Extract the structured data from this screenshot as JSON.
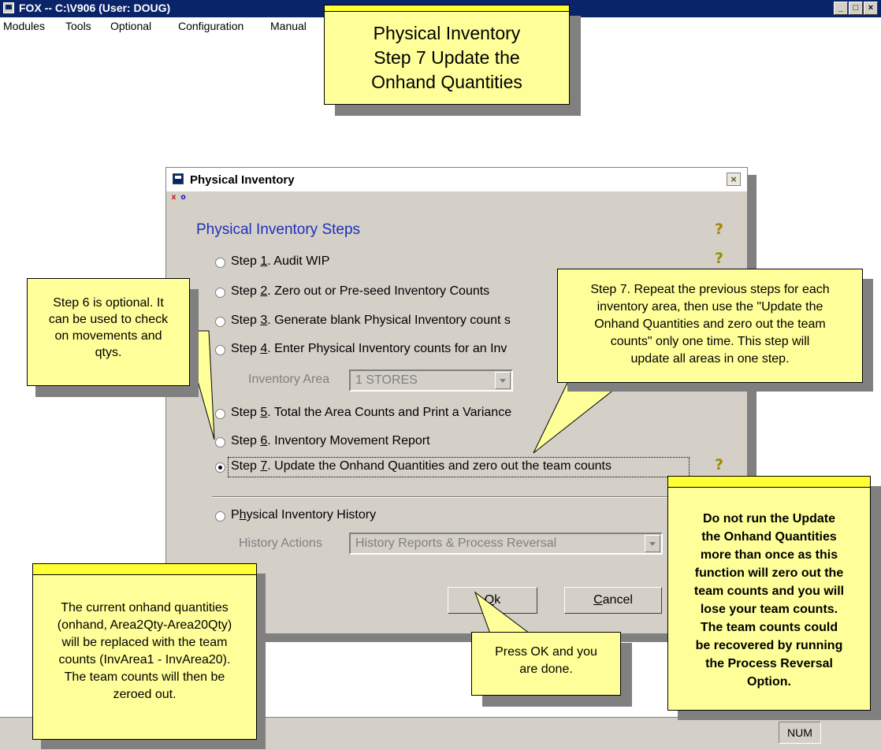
{
  "window": {
    "title": "FOX -- C:\\V906  (User: DOUG)",
    "controls": [
      "minimize",
      "maximize",
      "close"
    ]
  },
  "menu": [
    "Modules",
    "Tools",
    "Optional",
    "Configuration",
    "Manual"
  ],
  "dialog": {
    "title": "Physical Inventory",
    "mini_icons": [
      "x",
      "o"
    ],
    "heading": "Physical Inventory Steps",
    "steps": [
      {
        "prefix": "Step ",
        "key": "1",
        "rest": ".  Audit WIP"
      },
      {
        "prefix": "Step ",
        "key": "2",
        "rest": ".  Zero out or Pre-seed Inventory Counts"
      },
      {
        "prefix": "Step ",
        "key": "3",
        "rest": ".  Generate blank Physical Inventory count s"
      },
      {
        "prefix": "Step ",
        "key": "4",
        "rest": ".  Enter Physical Inventory counts for an Inv"
      },
      {
        "prefix": "Step ",
        "key": "5",
        "rest": ".  Total the Area Counts and Print a Variance"
      },
      {
        "prefix": "Step ",
        "key": "6",
        "rest": ".  Inventory Movement Report"
      },
      {
        "prefix": "Step ",
        "key": "7",
        "rest": ".  Update the Onhand Quantities and zero out the team counts"
      }
    ],
    "selected_step": "7",
    "inventory_area": {
      "label": "Inventory Area",
      "value": "1  STORES"
    },
    "history": {
      "prefix": "P",
      "key": "h",
      "rest": "ysical Inventory History"
    },
    "history_actions": {
      "label": "History Actions",
      "value": "History Reports & Process Reversal"
    },
    "ok_label": {
      "key": "O",
      "rest": "k"
    },
    "cancel_label": {
      "key": "C",
      "rest": "ancel"
    },
    "help_glyph": "?"
  },
  "status": {
    "num": "NUM"
  },
  "callouts": {
    "title": [
      "Physical Inventory",
      "Step 7 Update the",
      "Onhand Quantities"
    ],
    "step6": [
      "Step 6 is optional.  It",
      "can be used to check",
      "on movements and",
      "qtys."
    ],
    "step7": [
      "Step 7. Repeat the previous steps for each",
      "inventory area, then use the \"Update the",
      "Onhand Quantities and zero out the team",
      "counts\" only one time. This step will",
      "update all areas in one step."
    ],
    "warning": [
      "Do not run the Update",
      "the Onhand Quantities",
      "more than once as this",
      "function will zero out the",
      "team counts and you will",
      "lose your team counts.",
      "The team counts could",
      "be recovered by running",
      "the Process Reversal",
      "Option."
    ],
    "onhand": [
      "The current onhand quantities",
      "(onhand, Area2Qty-Area20Qty)",
      "will be replaced with the team",
      "counts (InvArea1 - InvArea20).",
      "The team counts will then be",
      "zeroed out."
    ],
    "ok": [
      "Press OK and you",
      "are done."
    ]
  }
}
